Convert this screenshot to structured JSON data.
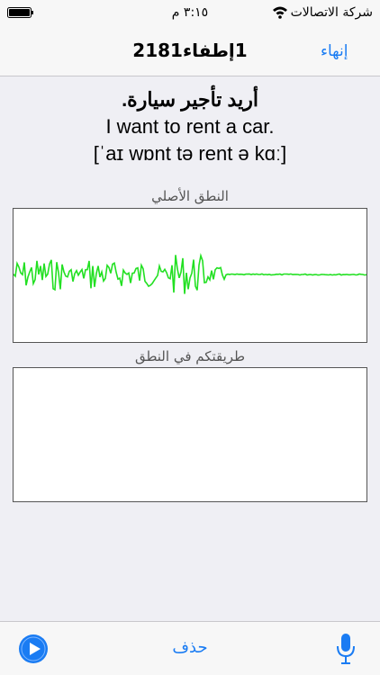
{
  "status_bar": {
    "carrier": "شركة الاتصالات",
    "time": "٣:١٥ م",
    "wifi_icon": "wifi-icon",
    "battery_icon": "battery-icon"
  },
  "nav": {
    "title": "1إطفاء2181",
    "finish_label": "إنهاء"
  },
  "phrase": {
    "arabic": "أريد تأجير سيارة.",
    "english": "I want to rent a car.",
    "ipa": "[ˈaɪ wɒnt tə rent ə kɑː]"
  },
  "original_section": {
    "label": "النطق الأصلي"
  },
  "recording_section": {
    "label": "طريقتكم في النطق"
  },
  "toolbar": {
    "play_icon": "play-icon",
    "delete_label": "حذف",
    "mic_icon": "microphone-icon"
  },
  "colors": {
    "accent": "#1a7cf3",
    "waveform": "#22e022"
  }
}
